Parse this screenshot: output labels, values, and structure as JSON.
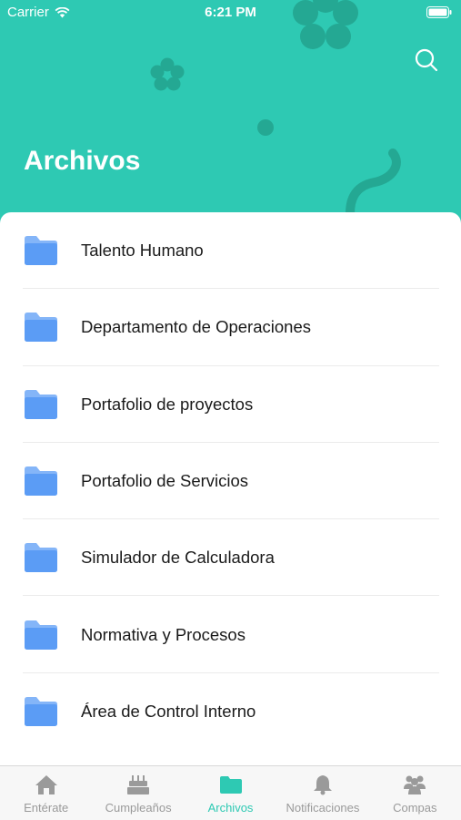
{
  "status_bar": {
    "carrier": "Carrier",
    "time": "6:21 PM"
  },
  "header": {
    "title": "Archivos",
    "background_color": "#2ec9b3",
    "deco_color": "#24a893",
    "search_icon": "search-icon"
  },
  "folders": [
    {
      "label": "Talento Humano",
      "icon": "folder-icon"
    },
    {
      "label": "Departamento de Operaciones",
      "icon": "folder-icon"
    },
    {
      "label": "Portafolio de proyectos",
      "icon": "folder-icon"
    },
    {
      "label": "Portafolio de Servicios",
      "icon": "folder-icon"
    },
    {
      "label": "Simulador de Calculadora",
      "icon": "folder-icon"
    },
    {
      "label": "Normativa y Procesos",
      "icon": "folder-icon"
    },
    {
      "label": "Área de Control Interno",
      "icon": "folder-icon"
    }
  ],
  "folder_color": "#5b9cf5",
  "tabbar": {
    "active_color": "#2ec9b3",
    "inactive_color": "#9a9a9a",
    "tabs": [
      {
        "label": "Entérate",
        "icon": "home-icon",
        "active": false
      },
      {
        "label": "Cumpleaños",
        "icon": "birthday-cake-icon",
        "active": false
      },
      {
        "label": "Archivos",
        "icon": "folder-icon",
        "active": true
      },
      {
        "label": "Notificaciones",
        "icon": "bell-icon",
        "active": false
      },
      {
        "label": "Compas",
        "icon": "people-icon",
        "active": false
      }
    ]
  }
}
